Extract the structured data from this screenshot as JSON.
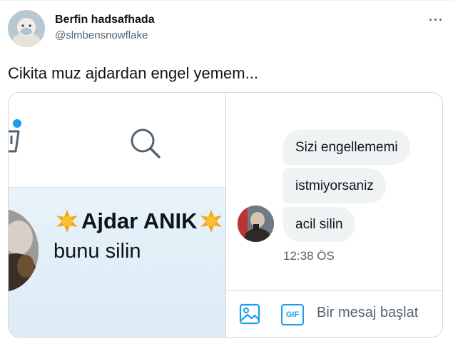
{
  "tweet": {
    "display_name": "Berfin hadsafhada",
    "handle": "@slmbensnowflake",
    "text": "Cikita muz ajdardan engel yemem...",
    "more_icon": "more-horizontal-icon"
  },
  "screenshot": {
    "contact": {
      "name": "Ajdar ANIK",
      "preview": "bunu silin",
      "name_decoration_icon": "star-emoji-icon"
    },
    "messages": [
      {
        "text": "Sizi engellememi"
      },
      {
        "text": "istmiyorsaniz"
      },
      {
        "text": "acil silin"
      }
    ],
    "timestamp": "12:38 ÖS",
    "compose": {
      "placeholder": "Bir mesaj başlat",
      "gif_label": "GIF"
    }
  },
  "colors": {
    "accent": "#1d9bf0",
    "bubble": "#eff3f4",
    "text": "#0f1419",
    "secondary_text": "#536471"
  }
}
